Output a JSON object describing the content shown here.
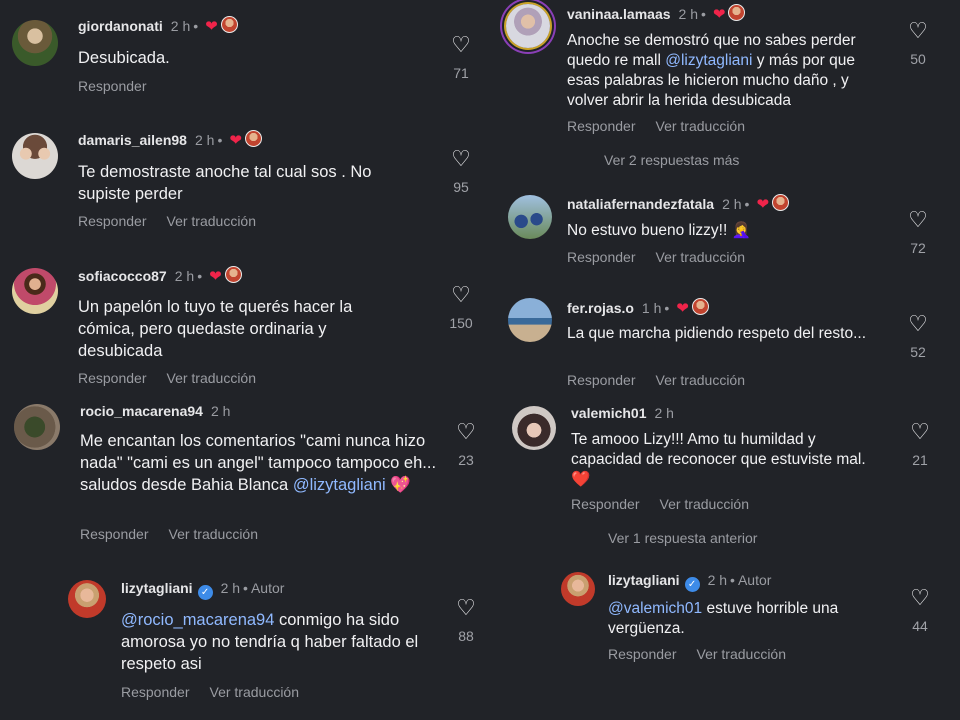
{
  "left": [
    {
      "user": "giordanonati",
      "time": "2 h",
      "text": "Desubicada.",
      "actions": [
        "Responder"
      ],
      "likes": "71",
      "hearts": true
    },
    {
      "user": "damaris_ailen98",
      "time": "2 h",
      "text": "Te demostraste anoche tal cual sos . No supiste perder",
      "actions": [
        "Responder",
        "Ver traducción"
      ],
      "likes": "95",
      "hearts": true
    },
    {
      "user": "sofiacocco87",
      "time": "2 h",
      "text": "Un papelón lo tuyo te querés hacer la cómica, pero quedaste ordinaria y desubicada",
      "actions": [
        "Responder",
        "Ver traducción"
      ],
      "likes": "150",
      "hearts": true
    },
    {
      "user": "rocio_macarena94",
      "time": "2 h",
      "text_before": "Me encantan los comentarios \"cami nunca hizo nada\" \"cami es un angel\"  tampoco tampoco eh... saludos desde Bahia Blanca ",
      "mention": "@lizytagliani",
      "emoji": "💖",
      "actions": [
        "Responder",
        "Ver traducción"
      ],
      "likes": "23",
      "hearts": false
    },
    {
      "user": "lizytagliani",
      "time": "2 h",
      "author": "Autor",
      "mention": "@rocio_macarena94",
      "text_after": " conmigo ha sido amorosa yo no tendría q haber faltado el respeto asi",
      "actions": [
        "Responder",
        "Ver traducción"
      ],
      "likes": "88"
    }
  ],
  "right": [
    {
      "user": "vaninaa.lamaas",
      "time": "2 h",
      "text_before": "Anoche se demostró que no sabes perder quedo re mall ",
      "mention": "@lizytagliani",
      "text_after": "  y más por que esas palabras le hicieron mucho daño , y volver abrir la herida desubicada",
      "actions": [
        "Responder",
        "Ver traducción"
      ],
      "likes": "50",
      "hearts": true,
      "more": "Ver 2 respuestas más"
    },
    {
      "user": "nataliafernandezfatala",
      "time": "2 h",
      "text": "No estuvo bueno lizzy!! 🤦‍♀️",
      "actions": [
        "Responder",
        "Ver traducción"
      ],
      "likes": "72",
      "hearts": true
    },
    {
      "user": "fer.rojas.o",
      "time": "1 h",
      "text": "La que marcha pidiendo respeto del resto...",
      "actions": [
        "Responder",
        "Ver traducción"
      ],
      "likes": "52",
      "hearts": true
    },
    {
      "user": "valemich01",
      "time": "2 h",
      "text": "Te amooo Lizy!!! Amo tu humildad y capacidad de reconocer que estuviste mal.❤️",
      "actions": [
        "Responder",
        "Ver traducción"
      ],
      "likes": "21",
      "hearts": false,
      "more": "Ver 1 respuesta anterior"
    },
    {
      "user": "lizytagliani",
      "time": "2 h",
      "author": "Autor",
      "mention": "@valemich01",
      "text_after": " estuve horrible una vergüenza.",
      "actions": [
        "Responder",
        "Ver traducción"
      ],
      "likes": "44"
    }
  ],
  "icons": {
    "like": "heart-outline-icon",
    "creator_like": "red-heart-icon",
    "verified": "verified-badge-icon"
  },
  "colors": {
    "bg": "#212328",
    "mention": "#90b9ff",
    "heart": "#f0244a",
    "verified": "#3d8be8"
  }
}
